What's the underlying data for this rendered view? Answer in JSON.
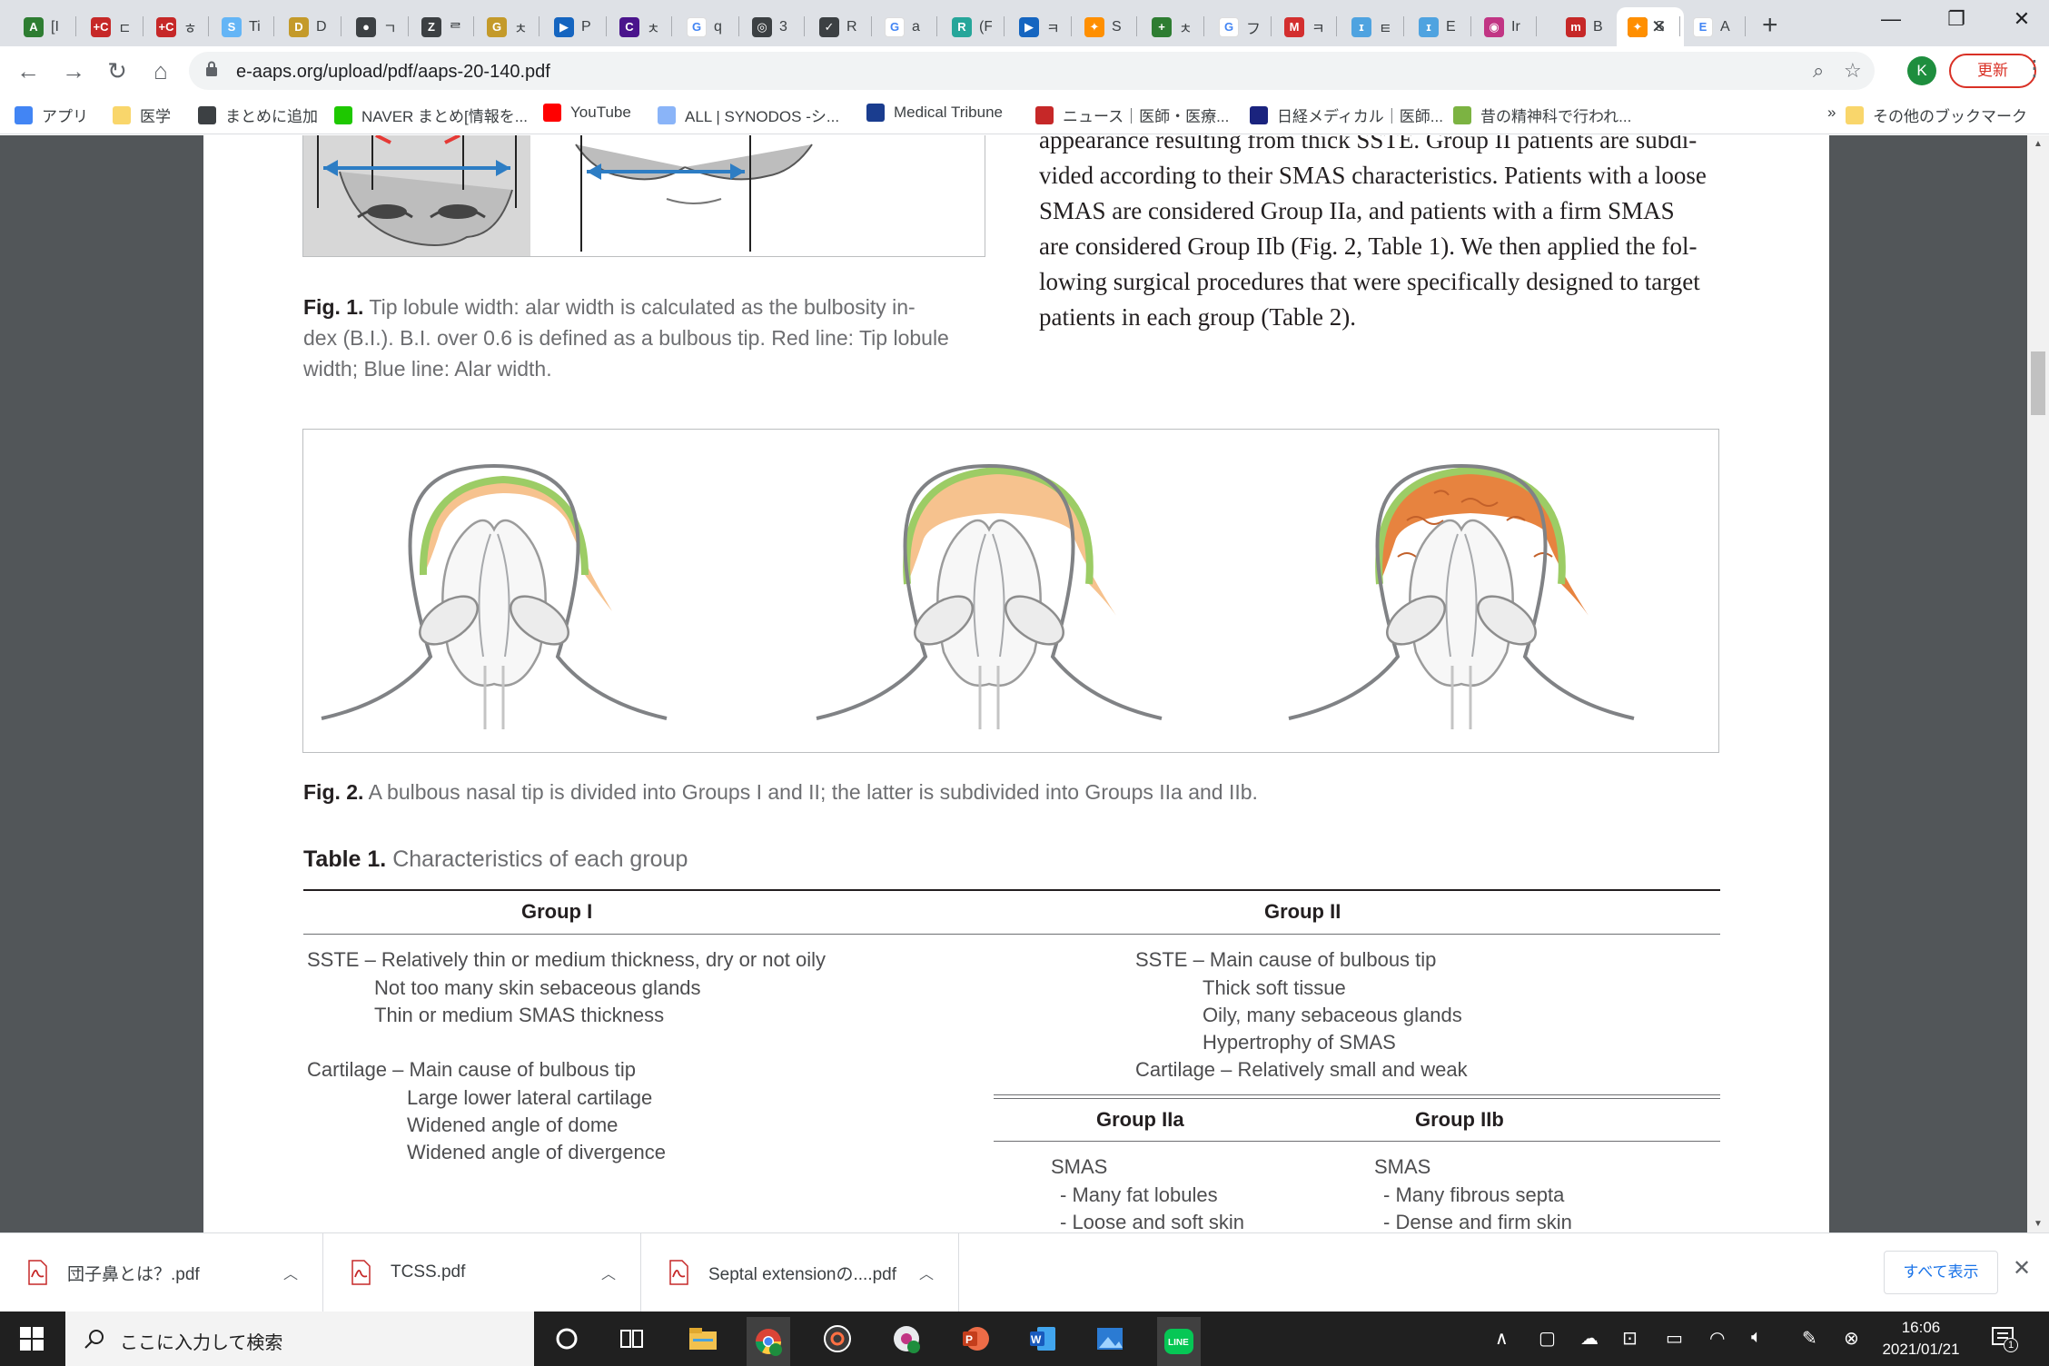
{
  "tabs": [
    {
      "label": "[I",
      "fav_color": "#2e7d32",
      "fav_glyph": "A"
    },
    {
      "label": "ㄷ",
      "fav_color": "#c62828",
      "fav_glyph": "+C"
    },
    {
      "label": "ㅎ",
      "fav_color": "#c62828",
      "fav_glyph": "+C"
    },
    {
      "label": "Ti",
      "fav_color": "#64b5f6",
      "fav_glyph": "S"
    },
    {
      "label": "D",
      "fav_color": "#c49a2a",
      "fav_glyph": "D"
    },
    {
      "label": "ㄱ",
      "fav_color": "#3c4043",
      "fav_glyph": "●"
    },
    {
      "label": "ᄅ",
      "fav_color": "#3c4043",
      "fav_glyph": "Z"
    },
    {
      "label": "ㅊ",
      "fav_color": "#c49a2a",
      "fav_glyph": "G"
    },
    {
      "label": "P",
      "fav_color": "#1565c0",
      "fav_glyph": "▶"
    },
    {
      "label": "ㅊ",
      "fav_color": "#4a148c",
      "fav_glyph": "C"
    },
    {
      "label": "q",
      "fav_color": "#ffffff",
      "fav_glyph": "G"
    },
    {
      "label": "3",
      "fav_color": "#3c4043",
      "fav_glyph": "◎"
    },
    {
      "label": "R",
      "fav_color": "#3c4043",
      "fav_glyph": "✓"
    },
    {
      "label": "a",
      "fav_color": "#ffffff",
      "fav_glyph": "G"
    },
    {
      "label": "(F",
      "fav_color": "#26a69a",
      "fav_glyph": "R"
    },
    {
      "label": "ㅋ",
      "fav_color": "#1565c0",
      "fav_glyph": "▶"
    },
    {
      "label": "S",
      "fav_color": "#ff8f00",
      "fav_glyph": "✦"
    },
    {
      "label": "ㅊ",
      "fav_color": "#2e7d32",
      "fav_glyph": "+"
    },
    {
      "label": "フ",
      "fav_color": "#ffffff",
      "fav_glyph": "G"
    },
    {
      "label": "ㅋ",
      "fav_color": "#d32f2f",
      "fav_glyph": "M"
    },
    {
      "label": "ㅌ",
      "fav_color": "#4fa3e0",
      "fav_glyph": "ɪ"
    },
    {
      "label": "E",
      "fav_color": "#4fa3e0",
      "fav_glyph": "ɪ"
    },
    {
      "label": "Ir",
      "fav_color": "#c13584",
      "fav_glyph": "◉"
    },
    {
      "label": "B",
      "fav_color": "#c62828",
      "fav_glyph": "m"
    },
    {
      "label": "",
      "fav_color": "#3c4043",
      "fav_glyph": "●",
      "active": true
    },
    {
      "label": "S",
      "fav_color": "#ff8f00",
      "fav_glyph": "✦"
    },
    {
      "label": "A",
      "fav_color": "#ffffff",
      "fav_glyph": "E"
    }
  ],
  "toolbar": {
    "url": "e-aaps.org/upload/pdf/aaps-20-140.pdf",
    "profile_initial": "K",
    "update_label": "更新"
  },
  "bookmarks": [
    {
      "label": "アプリ",
      "icon": "apps-icon",
      "color": "#4285f4"
    },
    {
      "label": "医学",
      "icon": "folder-icon",
      "color": "#f9d66b"
    },
    {
      "label": "まとめに追加",
      "icon": "globe-icon",
      "color": "#3c4043"
    },
    {
      "label": "NAVER まとめ[情報を...",
      "icon": "naver-icon",
      "color": "#1ec800"
    },
    {
      "label": "YouTube",
      "icon": "youtube-icon",
      "color": "#ff0000"
    },
    {
      "label": "ALL | SYNODOS -シ...",
      "icon": "synodos-icon",
      "color": "#8ab4f8"
    },
    {
      "label": "Medical Tribune",
      "icon": "medical-tribune-icon",
      "color": "#1a3d8f"
    },
    {
      "label": "ニュース｜医師・医療...",
      "icon": "carenet-icon",
      "color": "#c62828"
    },
    {
      "label": "日経メディカル｜医師...",
      "icon": "nikkei-icon",
      "color": "#1a237e"
    },
    {
      "label": "昔の精神科で行われ...",
      "icon": "leaf-icon",
      "color": "#7cb342"
    }
  ],
  "bookmarks_overflow": "»",
  "bookmarks_other": "その他のブックマーク",
  "pdf": {
    "body_lines": [
      "appearance resulting from thick SSTE. Group II patients are subdi-",
      "vided according to their SMAS characteristics. Patients with a loose",
      "SMAS are considered Group IIa, and patients with a firm SMAS",
      "are considered Group IIb (Fig. 2, Table 1). We then applied the fol-",
      "lowing surgical procedures that were specifically designed to target",
      "patients in each group (Table 2)."
    ],
    "fig1_caption_label": "Fig. 1.",
    "fig1_caption_lines": [
      " Tip lobule width: alar width is calculated as the bulbosity in-",
      "dex (B.I.). B.I. over 0.6 is defined as a bulbous tip. Red line: Tip lobule",
      "width; Blue line: Alar width."
    ],
    "fig2_caption_label": "Fig. 2.",
    "fig2_caption": " A bulbous nasal tip is divided into Groups I and II; the latter is subdivided into Groups IIa and IIb.",
    "table_label": "Table 1.",
    "table_title": " Characteristics of each group",
    "table": {
      "group1_header": "Group I",
      "group2_header": "Group II",
      "group1_rows": [
        "SSTE – Relatively thin or medium thickness, dry or not oily",
        "Not too many skin sebaceous glands",
        "Thin or medium SMAS thickness",
        "Cartilage – Main cause of bulbous tip",
        "Large lower lateral cartilage",
        "Widened angle of dome",
        "Widened angle of divergence"
      ],
      "group2_rows": [
        "SSTE – Main cause of bulbous tip",
        "Thick soft tissue",
        "Oily, many sebaceous glands",
        "Hypertrophy of SMAS",
        "Cartilage – Relatively small and weak"
      ],
      "group2a_header": "Group IIa",
      "group2b_header": "Group IIb",
      "group2a_rows": [
        "SMAS",
        "- Many fat lobules",
        "- Loose and soft skin"
      ],
      "group2b_rows": [
        "SMAS",
        "- Many fibrous septa",
        "- Dense and firm skin"
      ]
    }
  },
  "downloads": [
    {
      "name": "団子鼻とは？.pdf"
    },
    {
      "name": "TCSS.pdf"
    },
    {
      "name": "Septal extensionの....pdf"
    }
  ],
  "downloads_show_all": "すべて表示",
  "taskbar": {
    "search_placeholder": "ここに入力して検索",
    "time": "16:06",
    "date": "2021/01/21",
    "notification_count": "1"
  }
}
